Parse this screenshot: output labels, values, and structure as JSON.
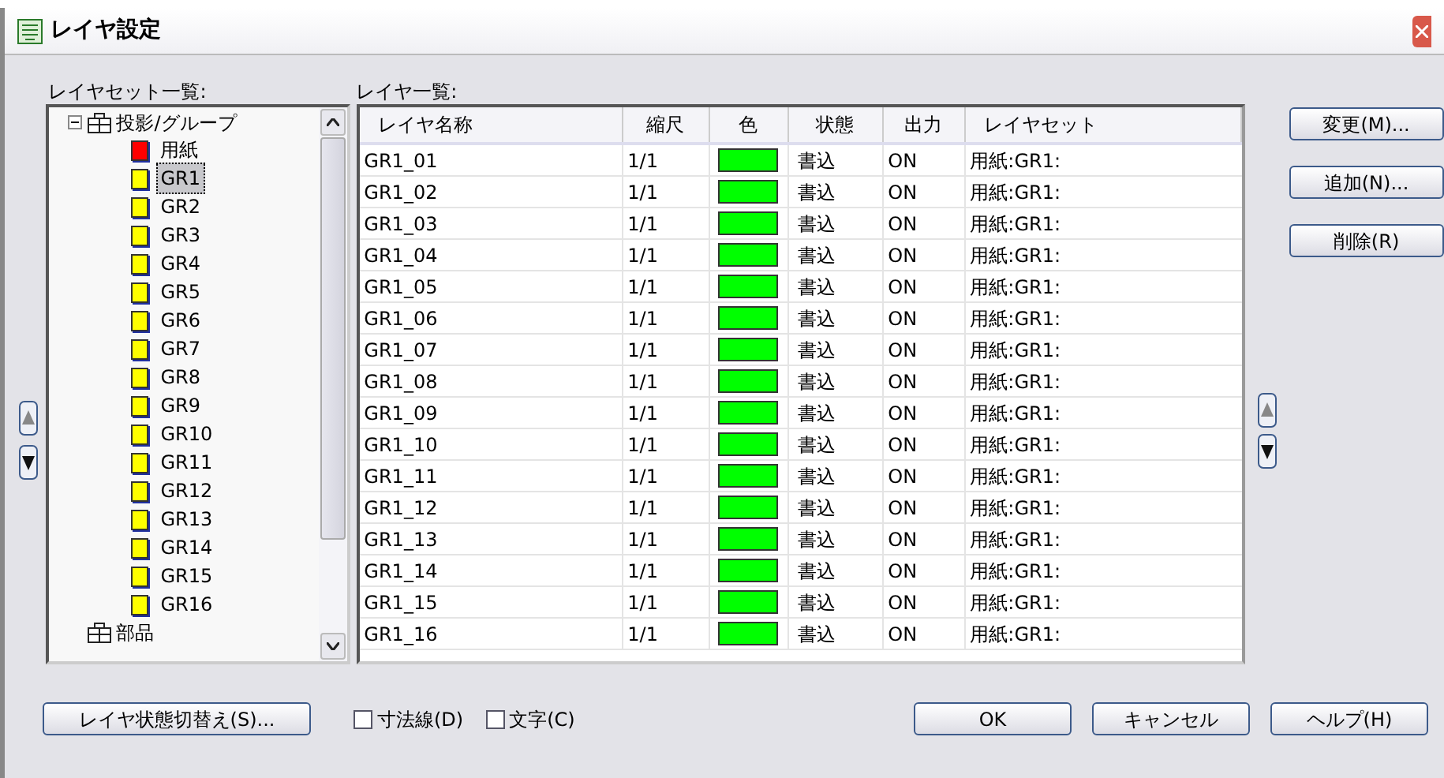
{
  "window": {
    "title": "レイヤ設定"
  },
  "layer_sets": {
    "label": "レイヤセット一覧:",
    "tree": [
      {
        "label": "投影/グループ",
        "expanded": true,
        "children": [
          {
            "label": "用紙",
            "color": "#ff0000",
            "selected": false
          },
          {
            "label": "GR1",
            "color": "#ffff00",
            "selected": true
          },
          {
            "label": "GR2",
            "color": "#ffff00",
            "selected": false
          },
          {
            "label": "GR3",
            "color": "#ffff00",
            "selected": false
          },
          {
            "label": "GR4",
            "color": "#ffff00",
            "selected": false
          },
          {
            "label": "GR5",
            "color": "#ffff00",
            "selected": false
          },
          {
            "label": "GR6",
            "color": "#ffff00",
            "selected": false
          },
          {
            "label": "GR7",
            "color": "#ffff00",
            "selected": false
          },
          {
            "label": "GR8",
            "color": "#ffff00",
            "selected": false
          },
          {
            "label": "GR9",
            "color": "#ffff00",
            "selected": false
          },
          {
            "label": "GR10",
            "color": "#ffff00",
            "selected": false
          },
          {
            "label": "GR11",
            "color": "#ffff00",
            "selected": false
          },
          {
            "label": "GR12",
            "color": "#ffff00",
            "selected": false
          },
          {
            "label": "GR13",
            "color": "#ffff00",
            "selected": false
          },
          {
            "label": "GR14",
            "color": "#ffff00",
            "selected": false
          },
          {
            "label": "GR15",
            "color": "#ffff00",
            "selected": false
          },
          {
            "label": "GR16",
            "color": "#ffff00",
            "selected": false
          }
        ]
      },
      {
        "label": "部品"
      }
    ]
  },
  "layers": {
    "label": "レイヤ一覧:",
    "columns": [
      "レイヤ名称",
      "縮尺",
      "色",
      "状態",
      "出力",
      "レイヤセット"
    ],
    "rows": [
      {
        "name": "GR1_01",
        "scale": "1/1",
        "color": "#00ff00",
        "state": "書込",
        "output": "ON",
        "layer_set": "用紙:GR1:"
      },
      {
        "name": "GR1_02",
        "scale": "1/1",
        "color": "#00ff00",
        "state": "書込",
        "output": "ON",
        "layer_set": "用紙:GR1:"
      },
      {
        "name": "GR1_03",
        "scale": "1/1",
        "color": "#00ff00",
        "state": "書込",
        "output": "ON",
        "layer_set": "用紙:GR1:"
      },
      {
        "name": "GR1_04",
        "scale": "1/1",
        "color": "#00ff00",
        "state": "書込",
        "output": "ON",
        "layer_set": "用紙:GR1:"
      },
      {
        "name": "GR1_05",
        "scale": "1/1",
        "color": "#00ff00",
        "state": "書込",
        "output": "ON",
        "layer_set": "用紙:GR1:"
      },
      {
        "name": "GR1_06",
        "scale": "1/1",
        "color": "#00ff00",
        "state": "書込",
        "output": "ON",
        "layer_set": "用紙:GR1:"
      },
      {
        "name": "GR1_07",
        "scale": "1/1",
        "color": "#00ff00",
        "state": "書込",
        "output": "ON",
        "layer_set": "用紙:GR1:"
      },
      {
        "name": "GR1_08",
        "scale": "1/1",
        "color": "#00ff00",
        "state": "書込",
        "output": "ON",
        "layer_set": "用紙:GR1:"
      },
      {
        "name": "GR1_09",
        "scale": "1/1",
        "color": "#00ff00",
        "state": "書込",
        "output": "ON",
        "layer_set": "用紙:GR1:"
      },
      {
        "name": "GR1_10",
        "scale": "1/1",
        "color": "#00ff00",
        "state": "書込",
        "output": "ON",
        "layer_set": "用紙:GR1:"
      },
      {
        "name": "GR1_11",
        "scale": "1/1",
        "color": "#00ff00",
        "state": "書込",
        "output": "ON",
        "layer_set": "用紙:GR1:"
      },
      {
        "name": "GR1_12",
        "scale": "1/1",
        "color": "#00ff00",
        "state": "書込",
        "output": "ON",
        "layer_set": "用紙:GR1:"
      },
      {
        "name": "GR1_13",
        "scale": "1/1",
        "color": "#00ff00",
        "state": "書込",
        "output": "ON",
        "layer_set": "用紙:GR1:"
      },
      {
        "name": "GR1_14",
        "scale": "1/1",
        "color": "#00ff00",
        "state": "書込",
        "output": "ON",
        "layer_set": "用紙:GR1:"
      },
      {
        "name": "GR1_15",
        "scale": "1/1",
        "color": "#00ff00",
        "state": "書込",
        "output": "ON",
        "layer_set": "用紙:GR1:"
      },
      {
        "name": "GR1_16",
        "scale": "1/1",
        "color": "#00ff00",
        "state": "書込",
        "output": "ON",
        "layer_set": "用紙:GR1:"
      }
    ]
  },
  "side_buttons": [
    "変更(M)...",
    "追加(N)...",
    "削除(R)"
  ],
  "toggle_button": "レイヤ状態切替え(S)...",
  "checkboxes": [
    {
      "label": "寸法線(D)",
      "checked": false
    },
    {
      "label": "文字(C)",
      "checked": false
    }
  ],
  "buttons": [
    "OK",
    "キャンセル",
    "ヘルプ(H)"
  ]
}
